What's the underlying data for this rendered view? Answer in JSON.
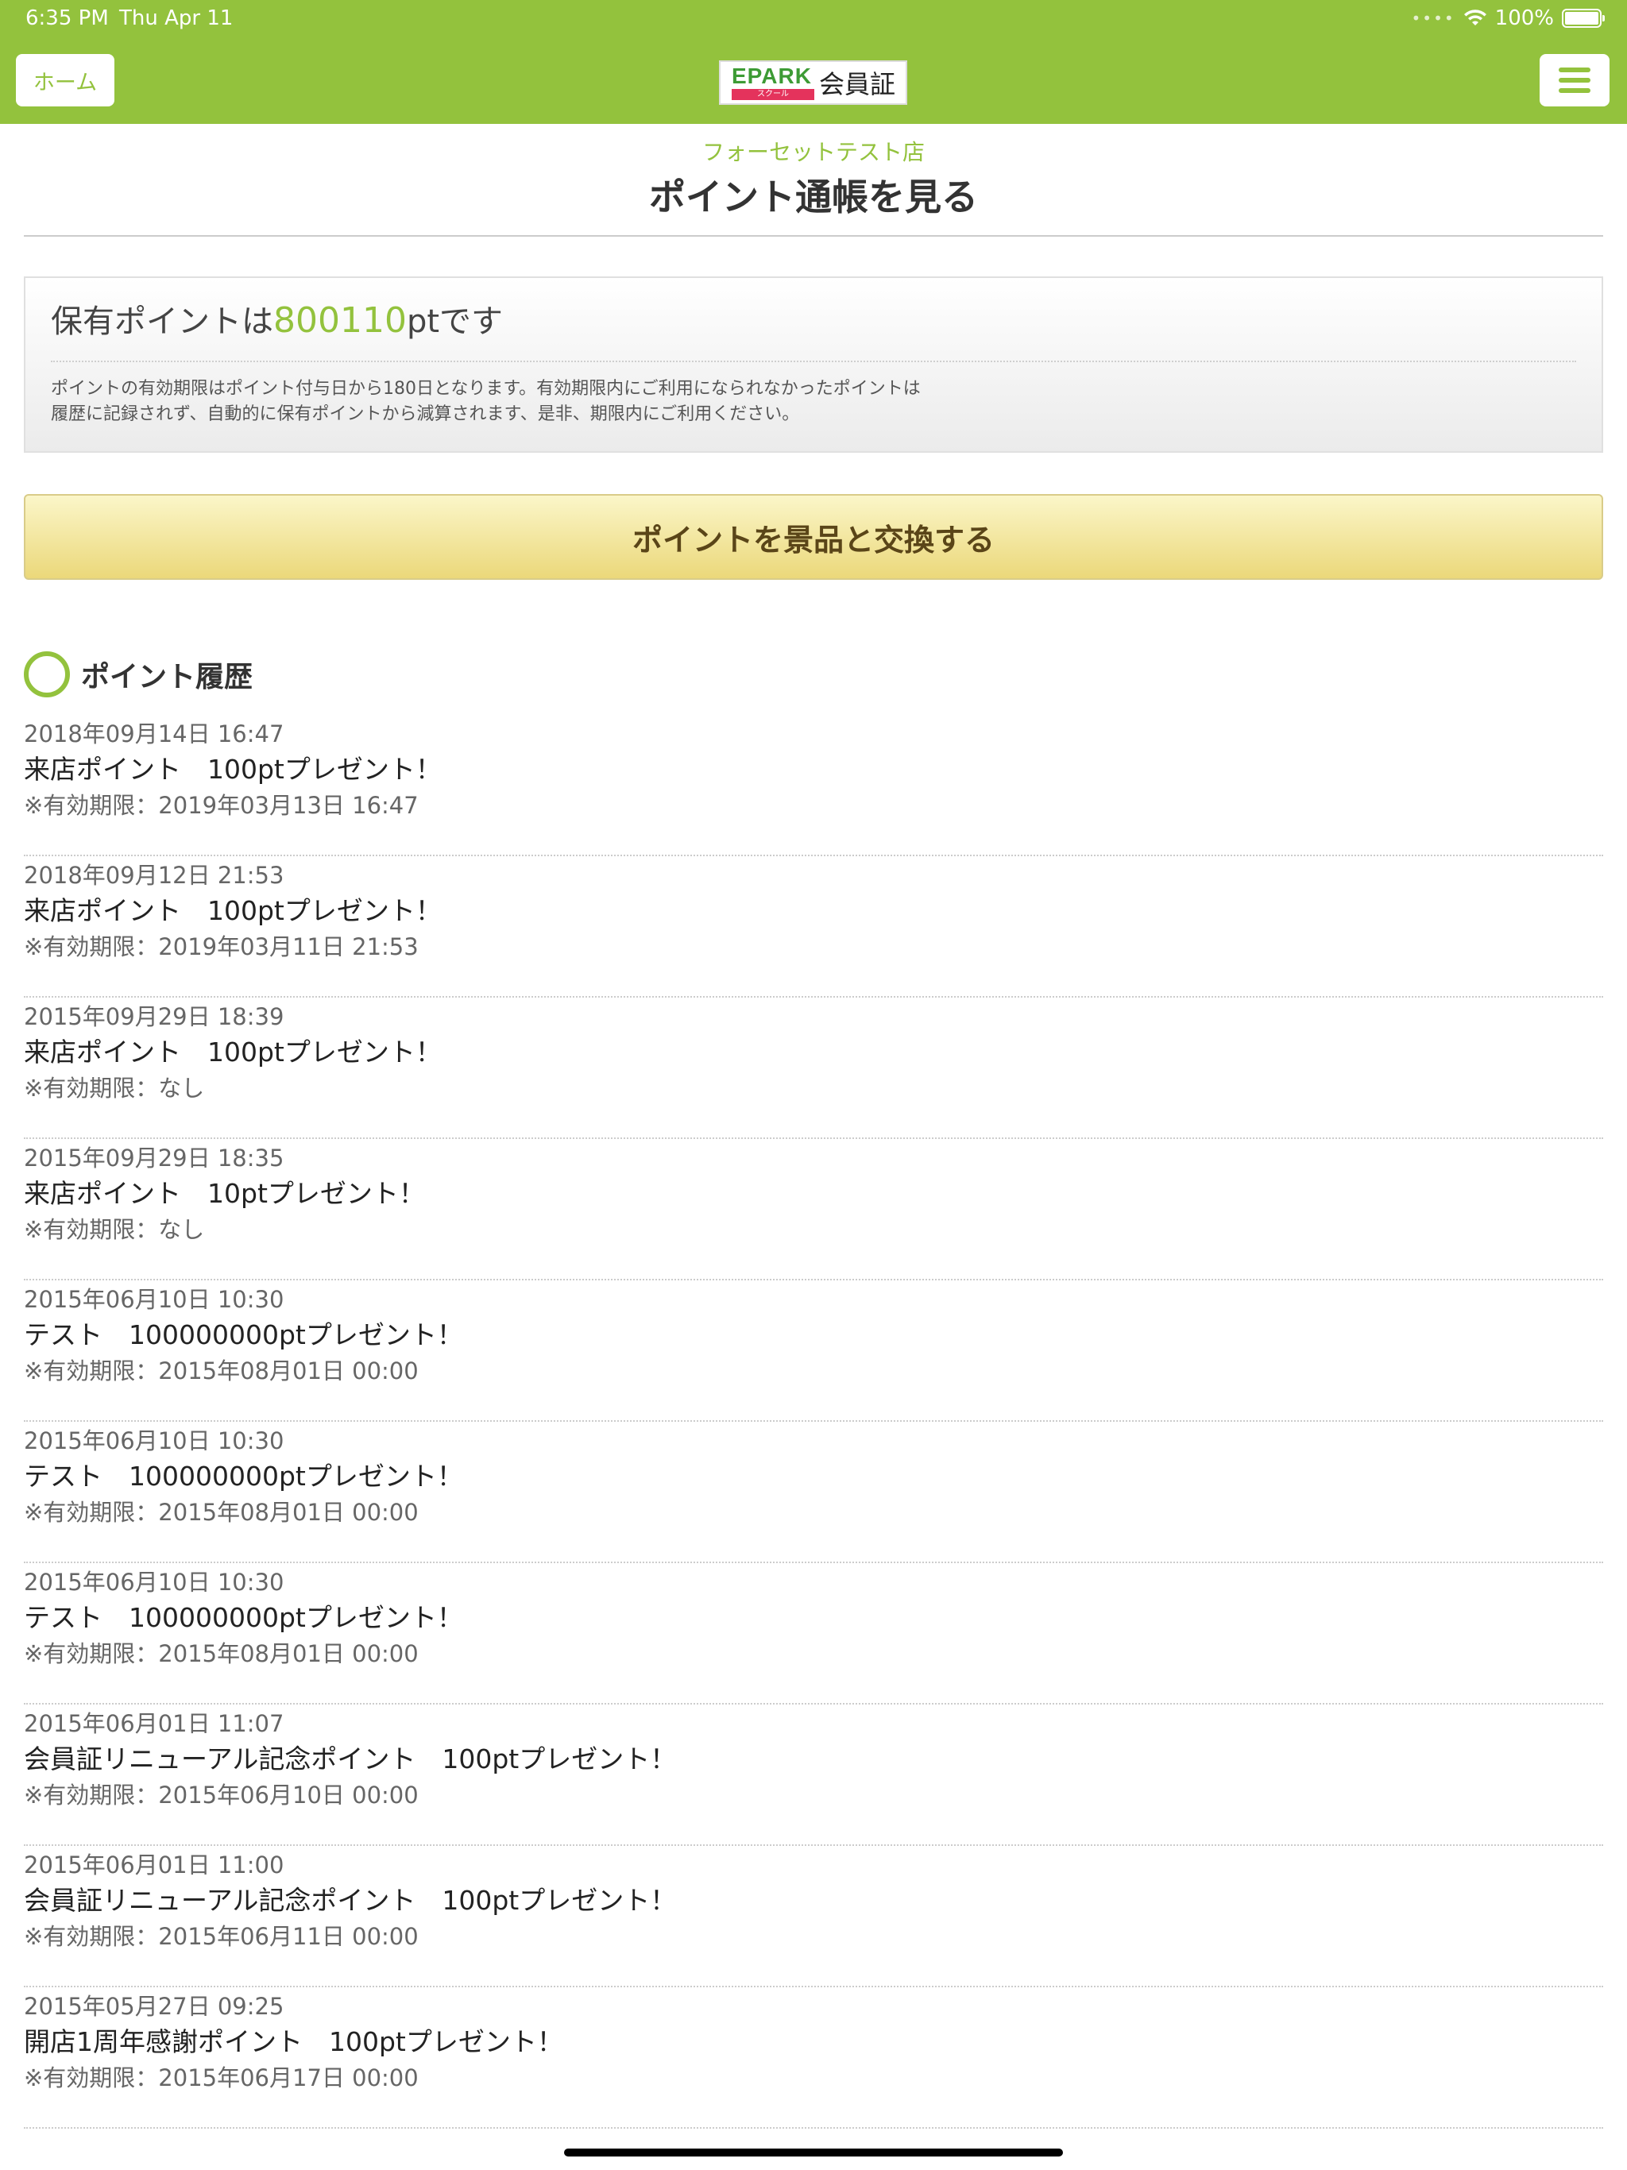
{
  "status_bar": {
    "time": "6:35 PM",
    "date": "Thu Apr 11",
    "battery": "100%"
  },
  "header": {
    "home_label": "ホーム",
    "logo_brand": "EPARK",
    "logo_sub": "スクール",
    "logo_title": "会員証",
    "brand_color": "#93c23d"
  },
  "page": {
    "store_name": "フォーセットテスト店",
    "title": "ポイント通帳を見る"
  },
  "points": {
    "prefix": "保有ポイントは",
    "value": "800110",
    "suffix": "ptです",
    "notice_line1": "ポイントの有効期限はポイント付与日から180日となります。有効期限内にご利用になられなかったポイントは",
    "notice_line2": "履歴に記録されず、自動的に保有ポイントから減算されます、是非、期限内にご利用ください。"
  },
  "exchange_button": {
    "label": "ポイントを景品と交換する"
  },
  "history": {
    "title": "ポイント履歴",
    "items": [
      {
        "datetime": "2018年09月14日 16:47",
        "description": "来店ポイント　100ptプレゼント！",
        "expiry": "※有効期限：2019年03月13日 16:47"
      },
      {
        "datetime": "2018年09月12日 21:53",
        "description": "来店ポイント　100ptプレゼント！",
        "expiry": "※有効期限：2019年03月11日 21:53"
      },
      {
        "datetime": "2015年09月29日 18:39",
        "description": "来店ポイント　100ptプレゼント！",
        "expiry": "※有効期限：なし"
      },
      {
        "datetime": "2015年09月29日 18:35",
        "description": "来店ポイント　10ptプレゼント！",
        "expiry": "※有効期限：なし"
      },
      {
        "datetime": "2015年06月10日 10:30",
        "description": "テスト　100000000ptプレゼント！",
        "expiry": "※有効期限：2015年08月01日 00:00"
      },
      {
        "datetime": "2015年06月10日 10:30",
        "description": "テスト　100000000ptプレゼント！",
        "expiry": "※有効期限：2015年08月01日 00:00"
      },
      {
        "datetime": "2015年06月10日 10:30",
        "description": "テスト　100000000ptプレゼント！",
        "expiry": "※有効期限：2015年08月01日 00:00"
      },
      {
        "datetime": "2015年06月01日 11:07",
        "description": "会員証リニューアル記念ポイント　100ptプレゼント！",
        "expiry": "※有効期限：2015年06月10日 00:00"
      },
      {
        "datetime": "2015年06月01日 11:00",
        "description": "会員証リニューアル記念ポイント　100ptプレゼント！",
        "expiry": "※有効期限：2015年06月11日 00:00"
      },
      {
        "datetime": "2015年05月27日 09:25",
        "description": "開店1周年感謝ポイント　100ptプレゼント！",
        "expiry": "※有効期限：2015年06月17日 00:00"
      }
    ]
  }
}
